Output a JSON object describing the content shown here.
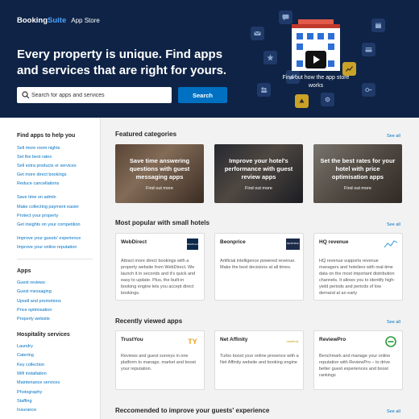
{
  "header": {
    "brand_part1": "Booking",
    "brand_part2": "Suite",
    "section": "App Store",
    "hero_title": "Every property is unique. Find apps and services that are right for yours.",
    "search_placeholder": "Search for apps and services",
    "search_button": "Search",
    "video_caption": "Find out how the app store works"
  },
  "sidebar": {
    "groups": [
      {
        "heading": "Find apps to help you",
        "links": [
          "Sell more room nights",
          "Set the best rates",
          "Sell extra products or services",
          "Get more direct bookings",
          "Reduce cancellations",
          "Save time on admin",
          "Make collecting payment easier",
          "Protect your property",
          "Get insights on your competition",
          "Improve your guests' experience",
          "Improve your online reputation"
        ]
      },
      {
        "heading": "Apps",
        "links": [
          "Guest reviews",
          "Guest messaging",
          "Upsell and promotions",
          "Price optimisation",
          "Property website"
        ]
      },
      {
        "heading": "Hospitality services",
        "links": [
          "Laundry",
          "Catering",
          "Key collection",
          "Wifi installation",
          "Maintenance services",
          "Photography",
          "Staffing",
          "Insurance"
        ]
      }
    ]
  },
  "featured": {
    "title": "Featured categories",
    "see_all": "See all",
    "cards": [
      {
        "title": "Save time answering questions with guest messaging apps",
        "more": "Find out more"
      },
      {
        "title": "Improve your hotel's performance with guest review apps",
        "more": "Find out more"
      },
      {
        "title": "Set the best rates for your hotel with price optimisation apps",
        "more": "Find out more"
      }
    ]
  },
  "popular": {
    "title": "Most popular with small hotels",
    "see_all": "See all",
    "apps": [
      {
        "name": "WebDirect",
        "logo_text": "WebDirect",
        "desc": "Attract more direct bookings with a property website from WebDirect. We launch it in seconds and it's quick and easy to update. Plus, the built-in booking engine lets you accept direct bookings."
      },
      {
        "name": "Beonprice",
        "logo_text": "BEONPRICE",
        "desc": "Artificial intelligence powered revenue. Make the best decisions at all times."
      },
      {
        "name": "HQ revenue",
        "logo_text": "",
        "desc": "HQ revenue supports revenue managers and hoteliers with real-time data on the most important distribution channels. It allows you to identify high-yield periods and periods of low demand at an early"
      }
    ]
  },
  "recent": {
    "title": "Recently viewed apps",
    "see_all": "See all",
    "apps": [
      {
        "name": "TrustYou",
        "logo_text": "TY",
        "desc": "Reviews and guest surveys in one platform to manage, market and boost your reputation."
      },
      {
        "name": "Net Affinity",
        "logo_text": "netaffinity",
        "desc": "Turbo boost your online presence with a Net Affinity website and booking engine"
      },
      {
        "name": "ReviewPro",
        "logo_text": "",
        "desc": "Benchmark and manage your online reputation with ReviewPro – to drive better guest experiences and boost rankings"
      }
    ]
  },
  "recommended": {
    "title": "Reccomended to improve your guests' experience",
    "see_all": "See all"
  },
  "colors": {
    "hero_bg": "#0e2346",
    "accent": "#0071c2",
    "link": "#0071c2",
    "page_bg": "#f2f2f2"
  }
}
